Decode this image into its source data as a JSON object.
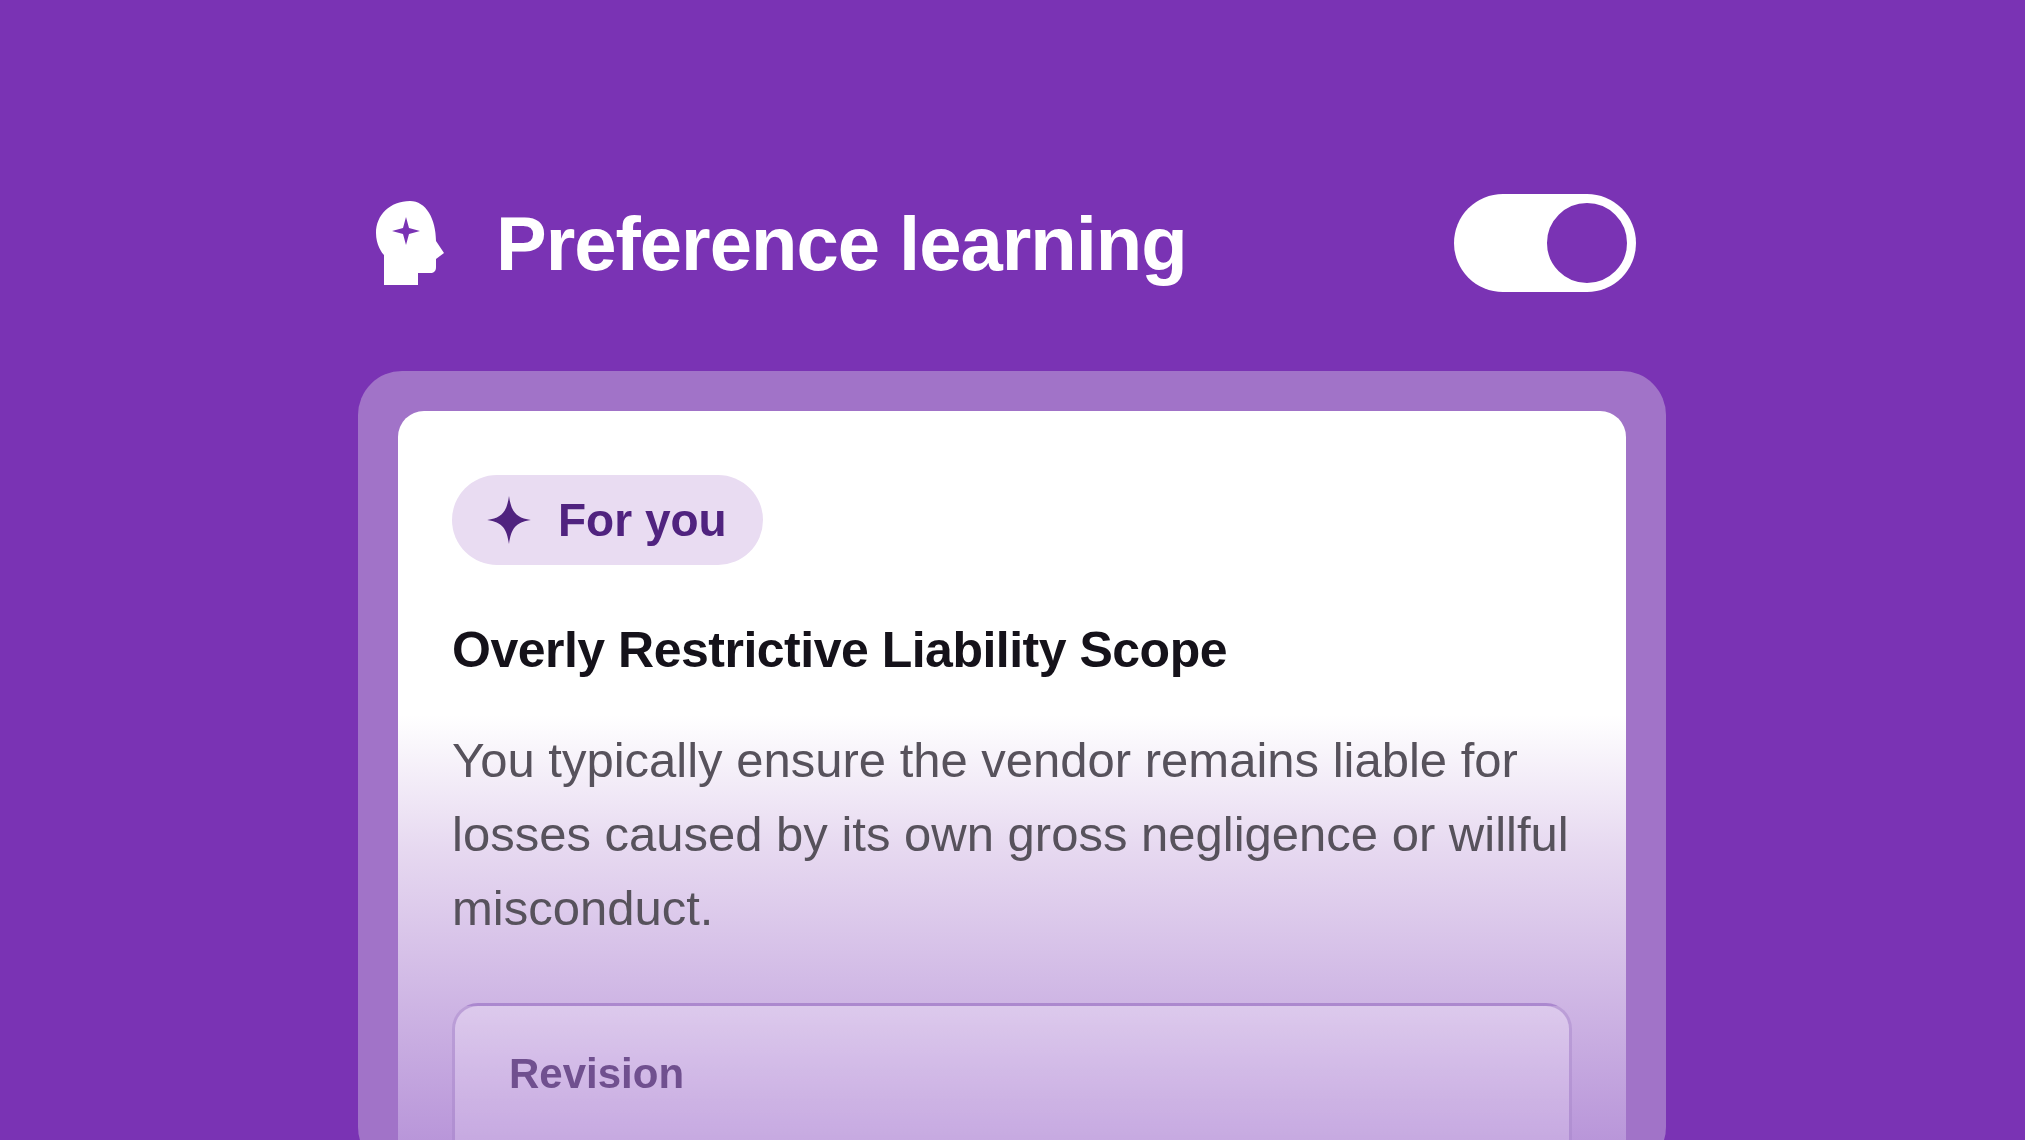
{
  "header": {
    "title": "Preference learning"
  },
  "toggle": {
    "on": true
  },
  "card": {
    "badge": "For you",
    "title": "Overly Restrictive Liability Scope",
    "body": "You typically ensure the vendor remains liable for losses caused by its own gross negligence or willful misconduct.",
    "revision": {
      "label": "Revision"
    }
  }
}
